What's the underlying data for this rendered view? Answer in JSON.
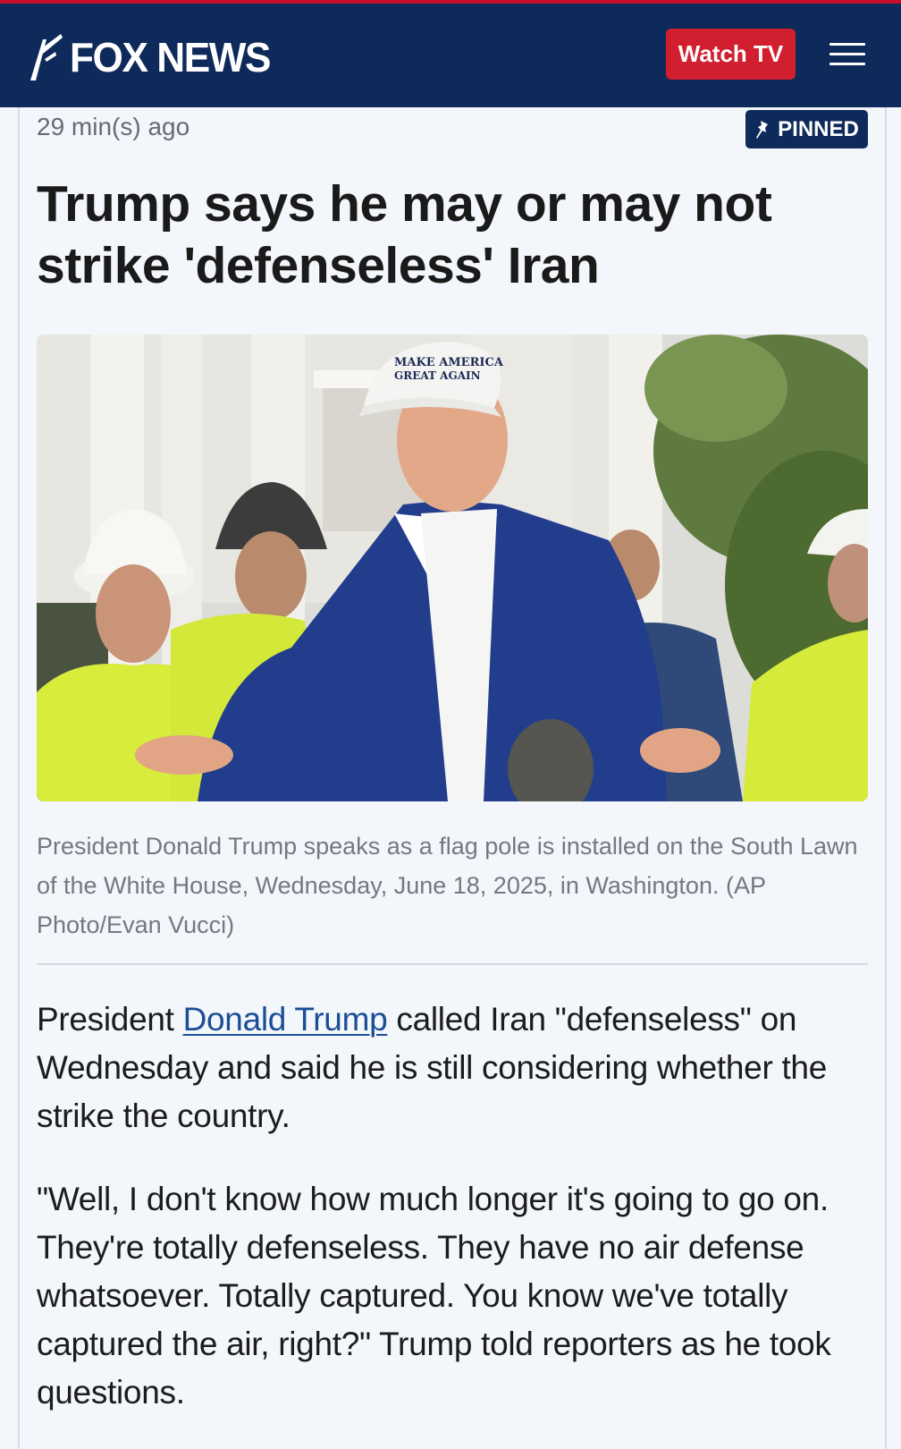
{
  "header": {
    "logo_text": "FOX NEWS",
    "watch_label": "Watch TV",
    "menu_icon": "hamburger-menu-icon",
    "colors": {
      "navy": "#0e2a5a",
      "red": "#d11f2f",
      "top_stripe": "#c8102e"
    }
  },
  "article": {
    "timestamp": "29 min(s) ago",
    "pinned_label": "PINNED",
    "pin_icon": "pin-icon",
    "headline": "Trump says he may or may not strike 'defenseless' Iran",
    "image_icon": "news-photo",
    "caption": "President Donald Trump speaks as a flag pole is installed on the South Lawn of the White House, Wednesday, June 18, 2025, in Washington. (AP Photo/Evan Vucci)",
    "hat_text_line1": "MAKE AMERICA",
    "hat_text_line2": "GREAT AGAIN",
    "para1": {
      "before": "President ",
      "link": "Donald Trump",
      "after": " called Iran \"defenseless\" on Wednesday and said he is still considering whether the strike the country."
    },
    "para2": "\"Well, I don't know how much longer it's going to go on. They're totally defenseless. They have no air defense whatsoever. Totally captured. You know we've totally captured the air, right?\" Trump told reporters as he took questions."
  }
}
